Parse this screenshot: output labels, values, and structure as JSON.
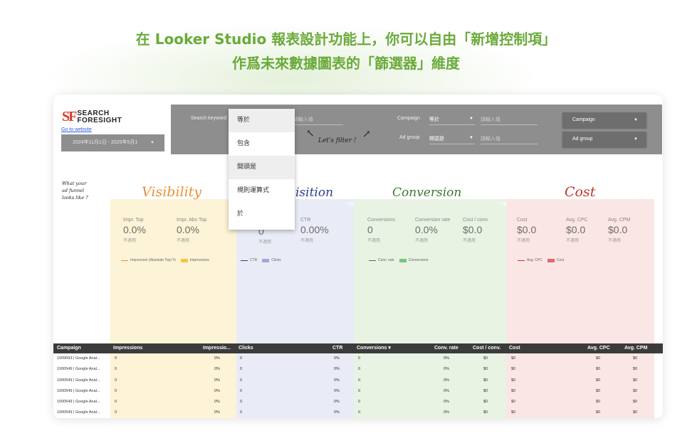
{
  "headline": {
    "line1": "在 Looker Studio 報表設計功能上，你可以自由「新增控制項」",
    "line2": "作爲未來數據圖表的「篩選器」維度"
  },
  "brand": {
    "mark": "SF",
    "line1": "SEARCH",
    "line2": "FORESIGHT",
    "link": "Go to website"
  },
  "date_range": "2024年11月1日 - 2025年5月1",
  "controls": {
    "search_keyword_label": "Search keyword",
    "search_input_placeholder": "請輸入值",
    "campaign_label": "Campaign",
    "campaign_operator": "等於",
    "campaign_placeholder": "請輸入值",
    "adgroup_label": "Ad group",
    "adgroup_operator": "開頭是",
    "adgroup_placeholder": "請輸入值",
    "campaign_button": "Campaign",
    "adgroup_button": "Ad group"
  },
  "dropdown_options": [
    "等於",
    "包含",
    "開頭是",
    "規則運算式",
    "於"
  ],
  "annotations": {
    "filter_note": "Let's filter !",
    "funnel_note": [
      "What your",
      "ad funnel",
      "looks like ?"
    ]
  },
  "sections": {
    "visibility": "Visibility",
    "acquisition": "isition",
    "conversion": "Conversion",
    "cost": "Cost"
  },
  "colors": {
    "visibility_bg": "#fdf3d6",
    "acquisition_bg": "#e9ecf6",
    "conversion_bg": "#e8f3e4",
    "cost_bg": "#fbe6e6",
    "visibility_title": "#e8913a",
    "acquisition_title": "#2c3e8c",
    "conversion_title": "#3a7a2e",
    "cost_title": "#c0392b"
  },
  "metrics": {
    "impr_top": {
      "label": "Impr. Top",
      "value": "0.0%",
      "sub": "不適用"
    },
    "impr_abs_top": {
      "label": "Impr. Abs Top",
      "value": "0.0%",
      "sub": "不適用"
    },
    "clicks": {
      "value": "0",
      "sub": "不適用"
    },
    "ctr": {
      "label": "CTR",
      "value": "0.00%",
      "sub": "不適用"
    },
    "conversions": {
      "label": "Conversions",
      "value": "0",
      "sub": "不適用"
    },
    "conv_rate": {
      "label": "Conversion rate",
      "value": "0.0%",
      "sub": "不適用"
    },
    "cost_conv": {
      "label": "Cost / conv.",
      "value": "$0.0",
      "sub": "不適用"
    },
    "cost": {
      "label": "Cost",
      "value": "$0.0",
      "sub": "不適用"
    },
    "avg_cpc": {
      "label": "Avg. CPC",
      "value": "$0.0",
      "sub": "不適用"
    },
    "avg_cpm": {
      "label": "Avg. CPM",
      "value": "$0.0",
      "sub": "不適用"
    }
  },
  "legends": {
    "visibility": [
      "Impression (Absolute Top) %",
      "Impressions"
    ],
    "acquisition": [
      "CTR",
      "Clicks"
    ],
    "conversion": [
      "Conv. rate",
      "Conversions"
    ],
    "cost": [
      "Avg. CPC",
      "Cost"
    ]
  },
  "table": {
    "headers": [
      "Campaign",
      "Impressions",
      "Impressio...",
      "Clicks",
      "CTR",
      "Conversions ▾",
      "Conv. rate",
      "Cost / conv.",
      "Cost",
      "Avg. CPC",
      "Avg. CPM"
    ],
    "rows": [
      [
        "1009693 | Google Anal...",
        "0",
        "0%",
        "0",
        "0%",
        "0",
        "0%",
        "$0",
        "$0",
        "$0",
        "$0"
      ],
      [
        "1000549 | Google Anal...",
        "0",
        "0%",
        "0",
        "0%",
        "0",
        "0%",
        "$0",
        "$0",
        "$0",
        "$0"
      ],
      [
        "1000549 | Google Anal...",
        "0",
        "0%",
        "0",
        "0%",
        "0",
        "0%",
        "$0",
        "$0",
        "$0",
        "$0"
      ],
      [
        "1000549 | Google Anal...",
        "0",
        "0%",
        "0",
        "0%",
        "0",
        "0%",
        "$0",
        "$0",
        "$0",
        "$0"
      ],
      [
        "1000549 | Google Anal...",
        "0",
        "0%",
        "0",
        "0%",
        "0",
        "0%",
        "$0",
        "$0",
        "$0",
        "$0"
      ],
      [
        "1000549 | Google Anal...",
        "0",
        "0%",
        "0",
        "0%",
        "0",
        "0%",
        "$0",
        "$0",
        "$0",
        "$0"
      ]
    ]
  }
}
